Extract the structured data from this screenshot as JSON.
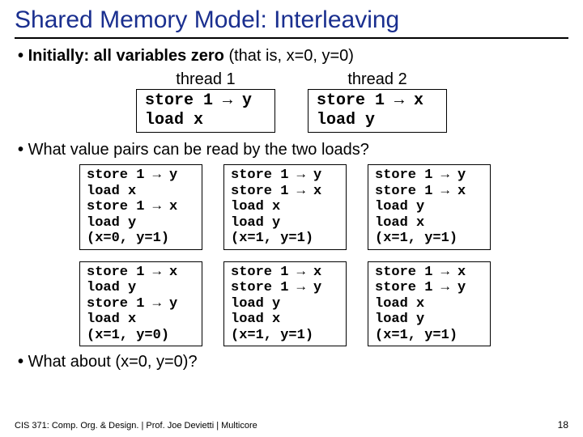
{
  "title": "Shared Memory Model: Interleaving",
  "bullet1_pre": "Initially: all variables zero ",
  "bullet1_post": "(that is, x=0, y=0)",
  "threads": {
    "t1": {
      "head": "thread 1",
      "body": "store 1 → y\nload x"
    },
    "t2": {
      "head": "thread 2",
      "body": "store 1 → x\nload y"
    }
  },
  "bullet2": "What value pairs can be read by the two loads?",
  "grid": [
    [
      "store 1 → y\nload x\nstore 1 → x\nload y\n(x=0, y=1)",
      "store 1 → y\nstore 1 → x\nload x\nload y\n(x=1, y=1)",
      "store 1 → y\nstore 1 → x\nload y\nload x\n(x=1, y=1)"
    ],
    [
      "store 1 → x\nload y\nstore 1 → y\nload x\n(x=1, y=0)",
      "store 1 → x\nstore 1 → y\nload y\nload x\n(x=1, y=1)",
      "store 1 → x\nstore 1 → y\nload x\nload y\n(x=1, y=1)"
    ]
  ],
  "bullet3": "What about (x=0, y=0)?",
  "footer": "CIS 371: Comp. Org. & Design. |  Prof. Joe Devietti  |  Multicore",
  "page": "18"
}
